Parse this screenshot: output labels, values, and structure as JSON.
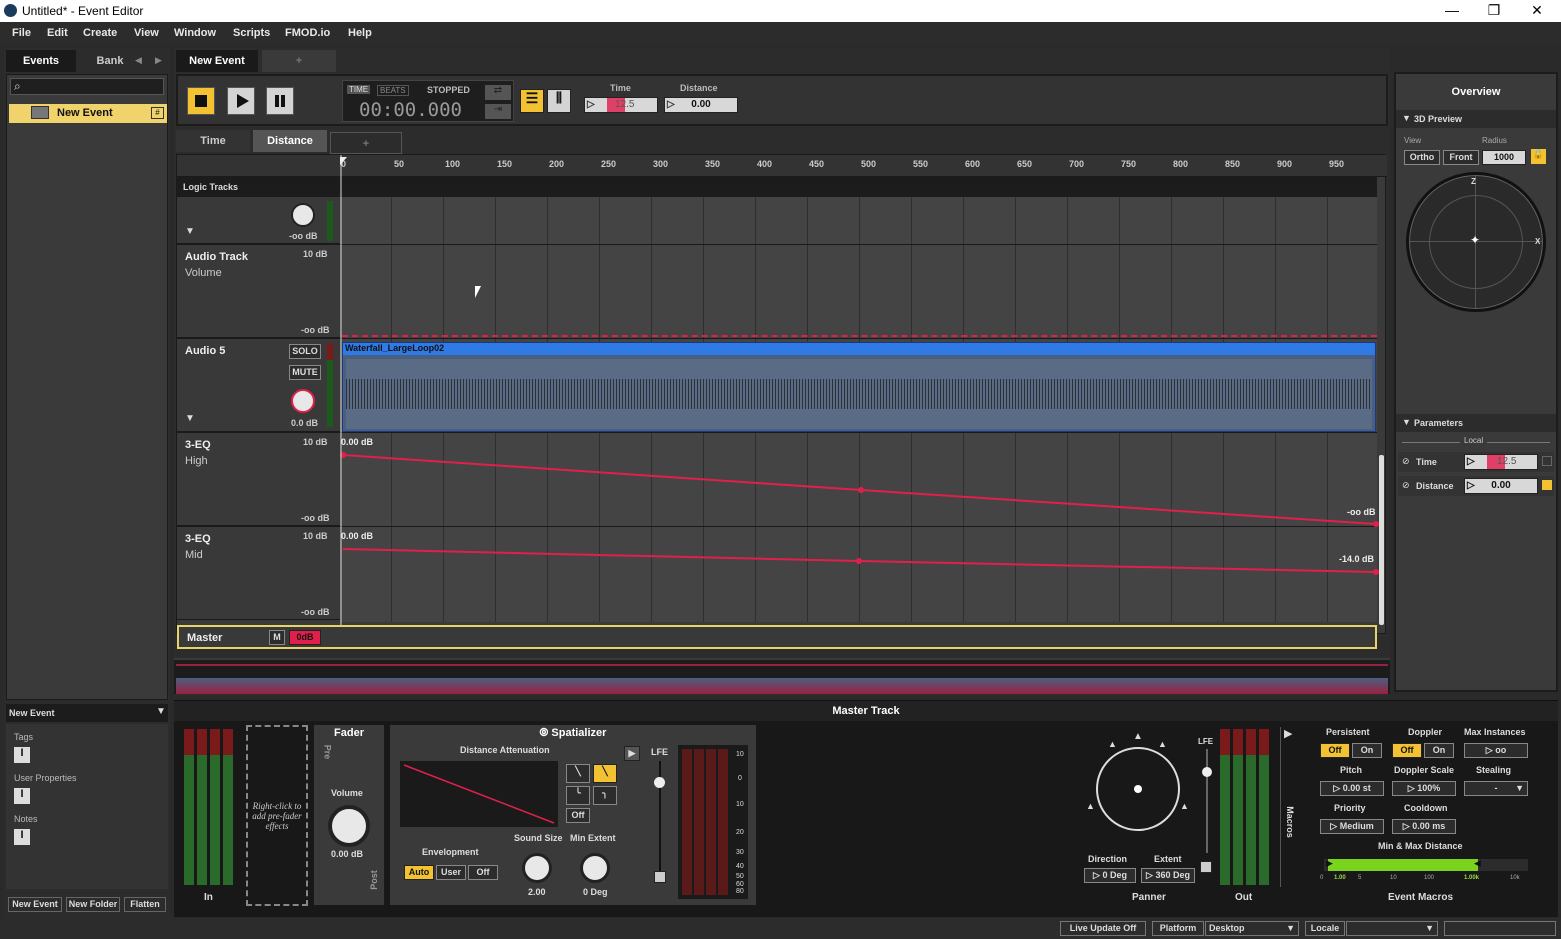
{
  "window": {
    "title": "Untitled* - Event Editor",
    "controls": [
      "—",
      "❐",
      "✕"
    ]
  },
  "menu": [
    "File",
    "Edit",
    "Create",
    "View",
    "Window",
    "Scripts",
    "FMOD.io",
    "Help"
  ],
  "browser": {
    "tabs": [
      "Events",
      "Bank"
    ],
    "selected_item": "New Event",
    "footer_title": "New Event",
    "sections": [
      "Tags",
      "User Properties",
      "Notes"
    ],
    "buttons": [
      "New Event",
      "New Folder",
      "Flatten"
    ]
  },
  "editor": {
    "event_tab": "New Event",
    "add_tab": "+",
    "transport": {
      "time_label": "TIME",
      "beats_label": "BEATS",
      "state": "STOPPED",
      "time": "00:00.000"
    },
    "params": {
      "time_label": "Time",
      "time_value": "12.5",
      "distance_label": "Distance",
      "distance_value": "0.00"
    },
    "param_tabs": [
      "Time",
      "Distance",
      "+"
    ],
    "ruler": [
      "0",
      "50",
      "100",
      "150",
      "200",
      "250",
      "300",
      "350",
      "400",
      "450",
      "500",
      "550",
      "600",
      "650",
      "700",
      "750",
      "800",
      "850",
      "900",
      "950",
      "1000"
    ],
    "logic_tracks": "Logic Tracks",
    "tracks": [
      {
        "name": "",
        "db": "-oo dB"
      },
      {
        "name": "Audio Track",
        "sub": "Volume",
        "top_db": "10 dB",
        "bottom_db": "-oo dB"
      },
      {
        "name": "Audio 5",
        "solo": "SOLO",
        "mute": "MUTE",
        "db": "0.0 dB",
        "clip": "Waterfall_LargeLoop02"
      },
      {
        "name": "3-EQ",
        "sub": "High",
        "top_db": "10 dB",
        "bottom_db": "-oo dB",
        "start": "0.00 dB",
        "end": "-oo dB"
      },
      {
        "name": "3-EQ",
        "sub": "Mid",
        "top_db": "10 dB",
        "bottom_db": "-oo dB",
        "start": "0.00 dB",
        "end": "-14.0 dB"
      },
      {
        "name": "Master",
        "m": "M",
        "db": "0dB"
      }
    ]
  },
  "overview": {
    "title": "Overview",
    "preview": {
      "label": "3D Preview",
      "view_label": "View",
      "radius_label": "Radius",
      "ortho": "Ortho",
      "front": "Front",
      "radius": "1000",
      "z": "Z",
      "x": "X"
    },
    "parameters": {
      "label": "Parameters",
      "local": "Local",
      "time_label": "Time",
      "time_value": "12.5",
      "distance_label": "Distance",
      "distance_value": "0.00"
    }
  },
  "master": {
    "title": "Master Track",
    "in_label": "In",
    "prefader_hint": "Right-click to add pre-fader effects",
    "fader": {
      "title": "Fader",
      "pre": "Pre",
      "post": "Post",
      "volume_label": "Volume",
      "volume": "0.00 dB"
    },
    "spatializer": {
      "title": "Spatializer",
      "distance_attenuation": "Distance Attenuation",
      "off": "Off",
      "envelopment": "Envelopment",
      "env_options": [
        "Auto",
        "User",
        "Off"
      ],
      "sound_size_label": "Sound Size",
      "sound_size": "2.00",
      "min_extent_label": "Min Extent",
      "min_extent": "0 Deg",
      "lfe": "LFE"
    },
    "meter_scale": [
      "10",
      "0",
      "10",
      "20",
      "30",
      "40",
      "50",
      "60",
      "80"
    ],
    "panner": {
      "label": "Panner",
      "lfe": "LFE",
      "direction_label": "Direction",
      "direction": "0 Deg",
      "extent_label": "Extent",
      "extent": "360 Deg"
    },
    "out_label": "Out",
    "macros": {
      "label": "Macros",
      "persistent_label": "Persistent",
      "doppler_label": "Doppler",
      "max_instances_label": "Max Instances",
      "off": "Off",
      "on": "On",
      "max_instances": "oo",
      "pitch_label": "Pitch",
      "pitch": "0.00 st",
      "doppler_scale_label": "Doppler Scale",
      "doppler_scale": "100%",
      "stealing_label": "Stealing",
      "stealing": "-",
      "priority_label": "Priority",
      "priority": "Medium",
      "cooldown_label": "Cooldown",
      "cooldown": "0.00 ms",
      "minmax_label": "Min & Max Distance",
      "minmax_scale": [
        "0",
        "1.00",
        "5",
        "10",
        "100",
        "1.00k",
        "10k"
      ],
      "footer": "Event Macros"
    }
  },
  "statusbar": {
    "live_update": "Live Update Off",
    "platform_label": "Platform",
    "platform": "Desktop",
    "locale_label": "Locale"
  }
}
